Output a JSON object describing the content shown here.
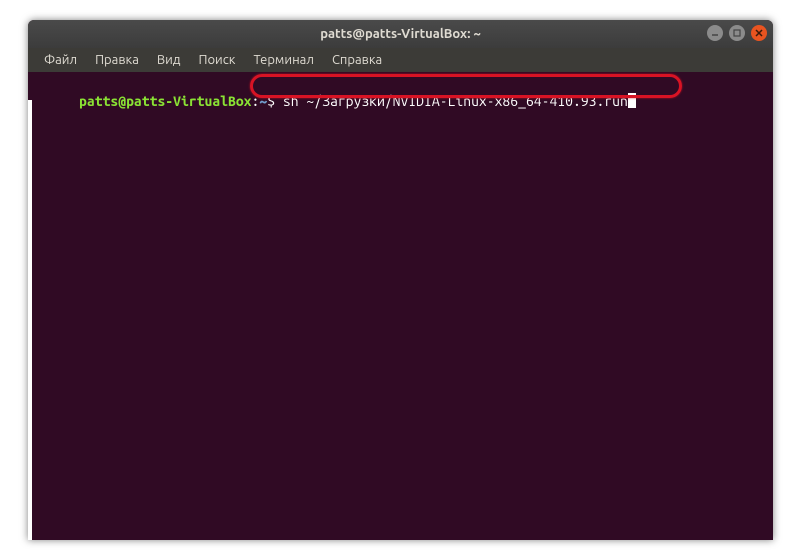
{
  "window": {
    "title": "patts@patts-VirtualBox: ~"
  },
  "menubar": {
    "items": [
      "Файл",
      "Правка",
      "Вид",
      "Поиск",
      "Терминал",
      "Справка"
    ]
  },
  "terminal": {
    "prompt_user": "patts@patts-VirtualBox",
    "prompt_colon": ":",
    "prompt_path": "~",
    "prompt_dollar": "$ ",
    "command": "sh ~/Загрузки/NVIDIA-Linux-x86_64-410.93.run"
  }
}
